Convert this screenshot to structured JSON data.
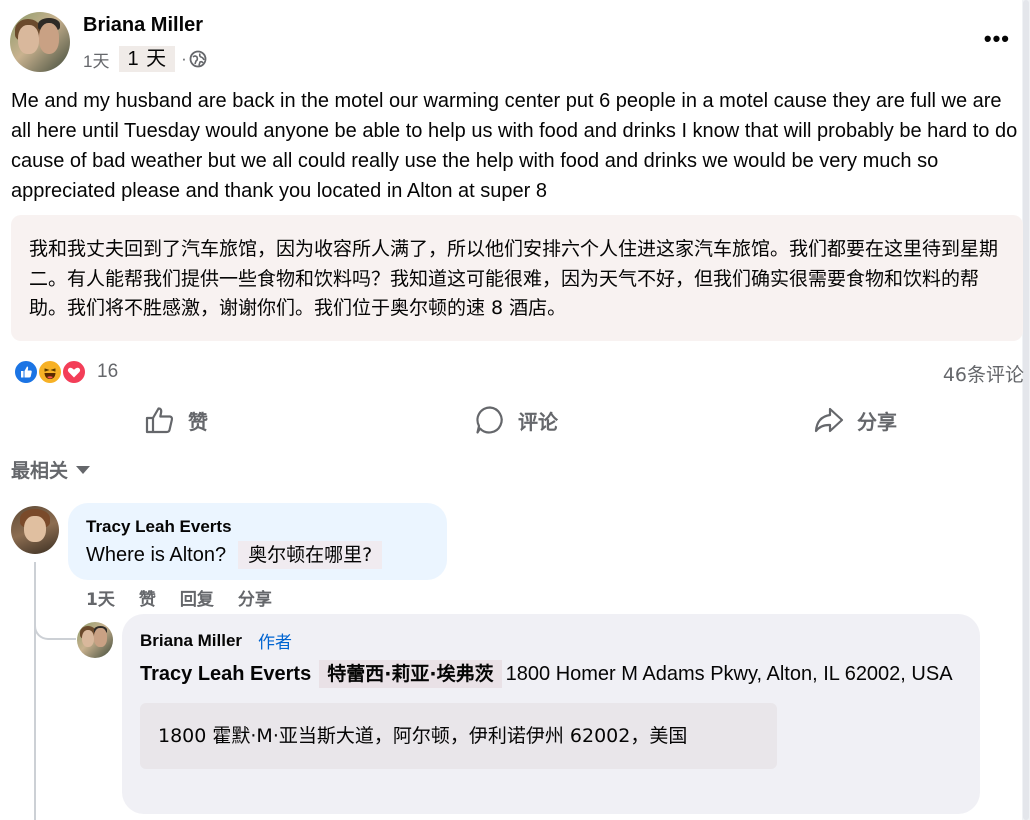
{
  "post": {
    "author": "Briana Miller",
    "time": "1天",
    "time_translation": "1 天",
    "meta_separator": "·",
    "body": "Me and my husband are back in the motel our warming center put 6 people in a motel cause they are full we are all here until Tuesday would anyone be able to help us with food and drinks I know that will probably be hard to do cause of bad weather but we all could really use the help with food and drinks we would be very much so appreciated please and thank you located in Alton at super 8",
    "translation": "我和我丈夫回到了汽车旅馆，因为收容所人满了，所以他们安排六个人住进这家汽车旅馆。我们都要在这里待到星期二。有人能帮我们提供一些食物和饮料吗？我知道这可能很难，因为天气不好，但我们确实很需要食物和饮料的帮助。我们将不胜感激，谢谢你们。我们位于奥尔顿的速 8 酒店。",
    "more_icon": "•••"
  },
  "reactions": {
    "icons": [
      "like-icon",
      "haha-icon",
      "love-icon"
    ],
    "count": "16",
    "comments_count": "46条评论"
  },
  "actions": {
    "like": "赞",
    "comment": "评论",
    "share": "分享"
  },
  "sort": {
    "label": "最相关"
  },
  "comments": [
    {
      "author": "Tracy Leah Everts",
      "text": "Where is Alton?",
      "translation": "奥尔顿在哪里?",
      "time": "1天",
      "like": "赞",
      "reply": "回复",
      "share": "分享"
    }
  ],
  "reply": {
    "author": "Briana Miller",
    "badge": "作者",
    "mention": "Tracy Leah Everts",
    "mention_translation": "特蕾西·莉亚·埃弗茨",
    "text": "1800 Homer M Adams Pkwy, Alton, IL 62002, USA",
    "translation": "1800 霍默·M·亚当斯大道，阿尔顿，伊利诺伊州 62002，美国"
  },
  "colors": {
    "accent": "#1b74e4",
    "muted_text": "#65676b",
    "author_badge": "#0064d1",
    "comment_bubble": "#ebf5ff",
    "reply_bubble": "#f0f0f5"
  }
}
